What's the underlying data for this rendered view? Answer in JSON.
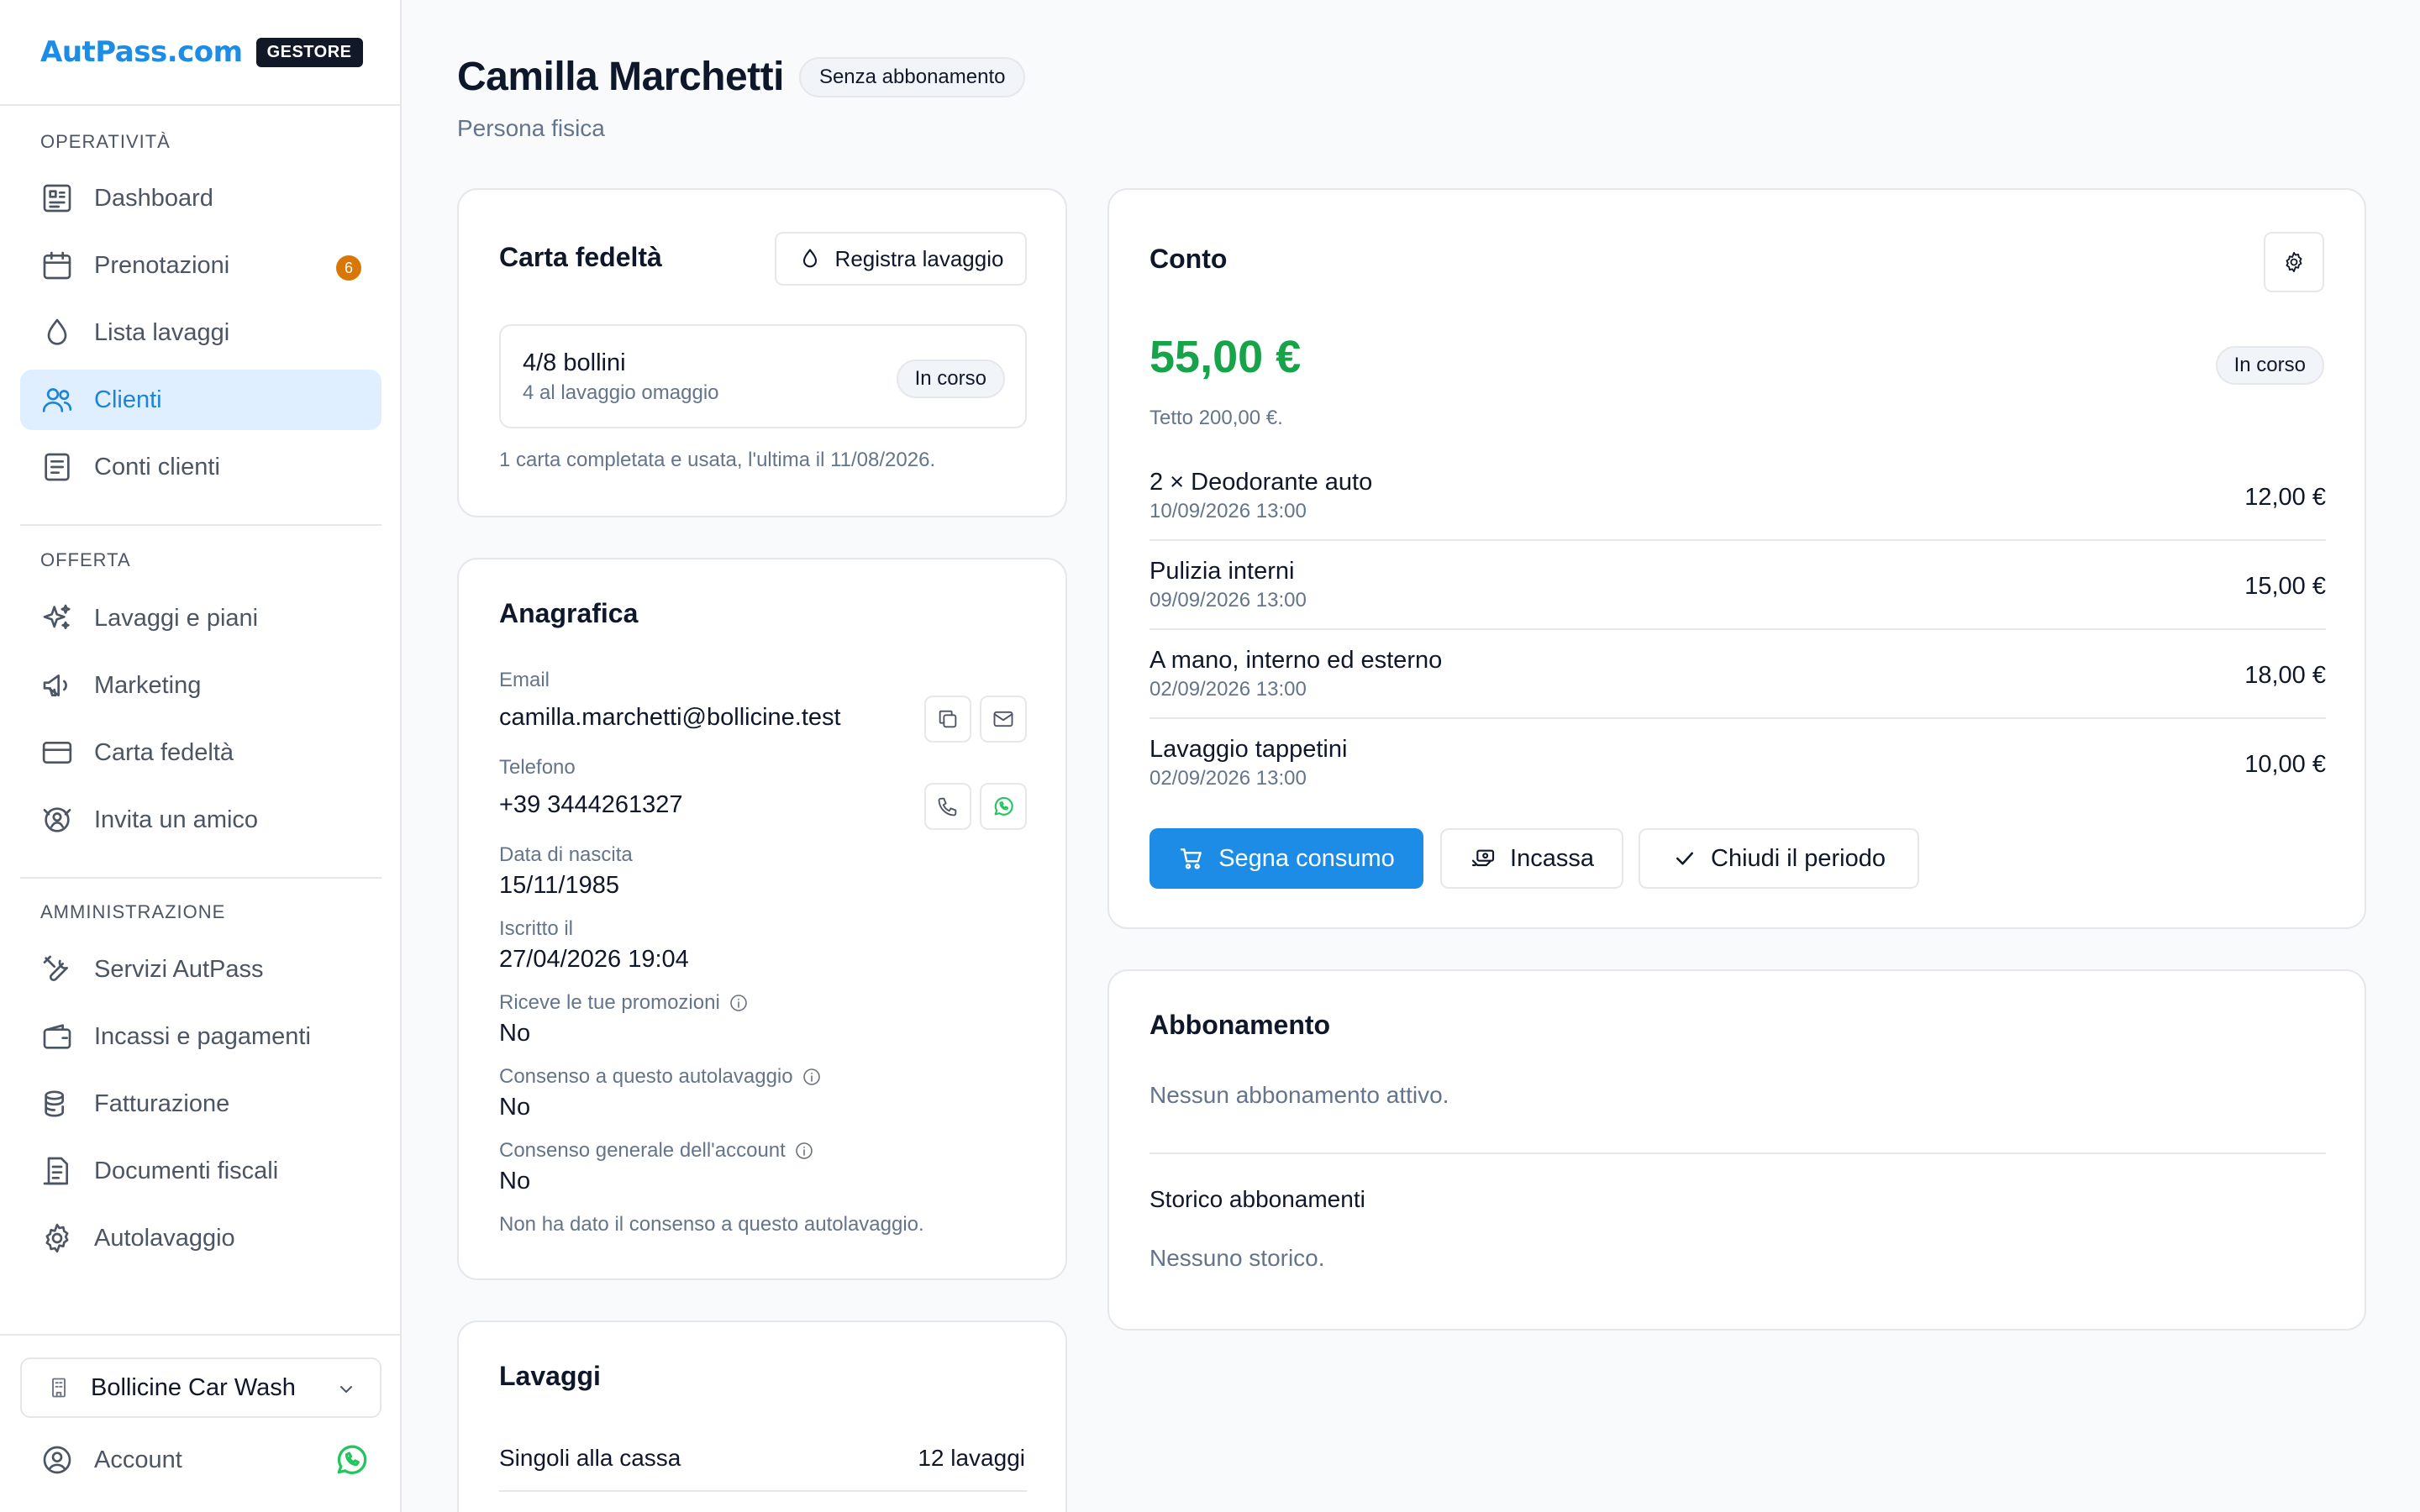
{
  "brand": {
    "logo": "AutPass.com",
    "badge": "GESTORE"
  },
  "sidebar": {
    "sections": [
      {
        "title": "OPERATIVITÀ",
        "items": [
          {
            "label": "Dashboard",
            "icon": "dashboard-icon"
          },
          {
            "label": "Prenotazioni",
            "icon": "calendar-icon",
            "badge": "6"
          },
          {
            "label": "Lista lavaggi",
            "icon": "drop-icon"
          },
          {
            "label": "Clienti",
            "icon": "users-icon",
            "active": true
          },
          {
            "label": "Conti clienti",
            "icon": "receipt-icon"
          }
        ]
      },
      {
        "title": "OFFERTA",
        "items": [
          {
            "label": "Lavaggi e piani",
            "icon": "sparkles-icon"
          },
          {
            "label": "Marketing",
            "icon": "megaphone-icon"
          },
          {
            "label": "Carta fedeltà",
            "icon": "card-icon"
          },
          {
            "label": "Invita un amico",
            "icon": "referral-icon"
          }
        ]
      },
      {
        "title": "AMMINISTRAZIONE",
        "items": [
          {
            "label": "Servizi AutPass",
            "icon": "tools-icon"
          },
          {
            "label": "Incassi e pagamenti",
            "icon": "wallet-icon"
          },
          {
            "label": "Fatturazione",
            "icon": "coins-icon"
          },
          {
            "label": "Documenti fiscali",
            "icon": "document-icon"
          },
          {
            "label": "Autolavaggio",
            "icon": "gear-icon"
          }
        ]
      }
    ],
    "site_select": "Bollicine Car Wash",
    "account": "Account"
  },
  "header": {
    "title": "Camilla Marchetti",
    "badge": "Senza abbonamento",
    "subtitle": "Persona fisica"
  },
  "loyalty": {
    "title": "Carta fedeltà",
    "button": "Registra lavaggio",
    "stamps": "4/8 bollini",
    "stamps_note": "4 al lavaggio omaggio",
    "status": "In corso",
    "footer": "1 carta completata e usata, l'ultima il 11/08/2026."
  },
  "registry": {
    "title": "Anagrafica",
    "email_label": "Email",
    "email": "camilla.marchetti@bollicine.test",
    "phone_label": "Telefono",
    "phone": "+39 3444261327",
    "birth_label": "Data di nascita",
    "birth": "15/11/1985",
    "signup_label": "Iscritto il",
    "signup": "27/04/2026 19:04",
    "promo_label": "Riceve le tue promozioni",
    "promo": "No",
    "consent_label": "Consenso a questo autolavaggio",
    "consent": "No",
    "general_label": "Consenso generale dell'account",
    "general": "No",
    "footer": "Non ha dato il consenso a questo autolavaggio."
  },
  "washes": {
    "title": "Lavaggi",
    "row_label": "Singoli alla cassa",
    "row_value": "12 lavaggi"
  },
  "account": {
    "title": "Conto",
    "amount": "55,00 €",
    "status": "In corso",
    "cap": "Tetto 200,00 €.",
    "lines": [
      {
        "name": "2 × Deodorante auto",
        "date": "10/09/2026 13:00",
        "amount": "12,00 €"
      },
      {
        "name": "Pulizia interni",
        "date": "09/09/2026 13:00",
        "amount": "15,00 €"
      },
      {
        "name": "A mano, interno ed esterno",
        "date": "02/09/2026 13:00",
        "amount": "18,00 €"
      },
      {
        "name": "Lavaggio tappetini",
        "date": "02/09/2026 13:00",
        "amount": "10,00 €"
      }
    ],
    "btn_consume": "Segna consumo",
    "btn_collect": "Incassa",
    "btn_close": "Chiudi il periodo"
  },
  "subscription": {
    "title": "Abbonamento",
    "none": "Nessun abbonamento attivo.",
    "history_title": "Storico abbonamenti",
    "history_none": "Nessuno storico."
  },
  "colors": {
    "accent": "#1d8ce6",
    "amount_green": "#16a34a",
    "badge_orange": "#d97706",
    "whatsapp": "#22c55e"
  }
}
